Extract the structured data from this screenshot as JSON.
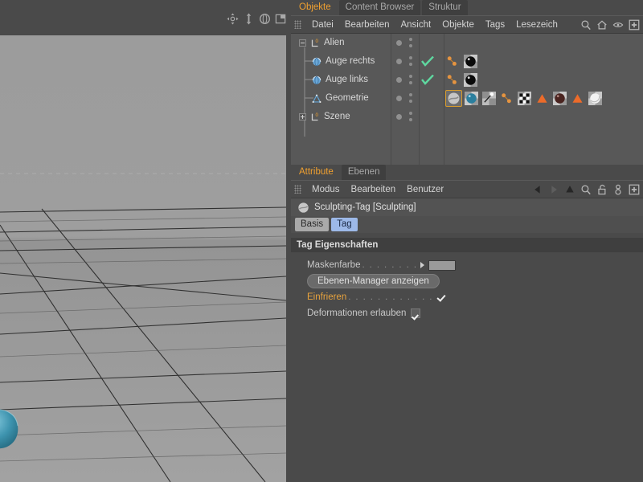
{
  "viewport": {
    "nav_icons": [
      "pan-icon",
      "dolly-icon",
      "rotate-icon",
      "view-panel-icon"
    ]
  },
  "object_manager": {
    "tabs": [
      {
        "label": "Objekte",
        "active": true
      },
      {
        "label": "Content Browser",
        "active": false
      },
      {
        "label": "Struktur",
        "active": false
      }
    ],
    "menu": [
      "Datei",
      "Bearbeiten",
      "Ansicht",
      "Objekte",
      "Tags",
      "Lesezeich"
    ],
    "menu_icons": [
      "search-icon",
      "home-icon",
      "eye-icon",
      "plus-icon"
    ],
    "rows": [
      {
        "name": "Alien",
        "icon": "null-object-icon",
        "depth": 0,
        "expander": "minus",
        "checkmark": false,
        "tags": []
      },
      {
        "name": "Auge rechts",
        "icon": "sphere-icon",
        "depth": 1,
        "expander": "none",
        "checkmark": true,
        "tags": [
          "xpresso-tag-icon",
          "material-tag-black-icon"
        ]
      },
      {
        "name": "Auge links",
        "icon": "sphere-icon",
        "depth": 1,
        "expander": "none",
        "checkmark": true,
        "tags": [
          "xpresso-tag-icon",
          "material-tag-black-icon"
        ]
      },
      {
        "name": "Geometrie",
        "icon": "polygon-object-icon",
        "depth": 1,
        "expander": "none",
        "checkmark": false,
        "tags": [
          "sculpting-tag-icon",
          "material-tag-blue-icon",
          "vertex-map-tag-icon",
          "xpresso-tag-icon",
          "checker-tag-icon",
          "selection-tag-icon",
          "material-tag-darkred-icon",
          "selection-tag-icon",
          "material-tag-white-icon"
        ],
        "selected_tag_index": 0
      },
      {
        "name": "Szene",
        "icon": "null-object-icon",
        "depth": 0,
        "expander": "plus",
        "checkmark": false,
        "tags": []
      }
    ]
  },
  "attribute_manager": {
    "tabs": [
      {
        "label": "Attribute",
        "active": true
      },
      {
        "label": "Ebenen",
        "active": false
      }
    ],
    "menu": [
      "Modus",
      "Bearbeiten",
      "Benutzer"
    ],
    "menu_icons": [
      "back-arrow-icon",
      "forward-arrow-icon",
      "up-arrow-icon",
      "search-icon",
      "unlock-icon",
      "user-icon",
      "plus-icon"
    ],
    "object_title": "Sculpting-Tag [Sculpting]",
    "object_icon": "sculpting-tag-icon",
    "subtabs": [
      {
        "label": "Basis",
        "active": false
      },
      {
        "label": "Tag",
        "active": true
      }
    ],
    "group_title": "Tag Eigenschaften",
    "properties": {
      "mask_color_label": "Maskenfarbe",
      "mask_color_dots": ". . . . . . . .",
      "mask_color_value": "#9a9a9a",
      "layer_manager_button": "Ebenen-Manager anzeigen",
      "freeze_label": "Einfrieren",
      "freeze_dots": ". . . . . . . . . . . .",
      "freeze_checked": true,
      "deform_label": "Deformationen erlauben",
      "deform_checked": true
    }
  },
  "colors": {
    "accent_orange": "#f0a030",
    "panel_bg": "#4a4a4a",
    "list_bg": "#585858",
    "selection_blue": "#9db9e8",
    "tag_select_border": "#d79b2c"
  }
}
